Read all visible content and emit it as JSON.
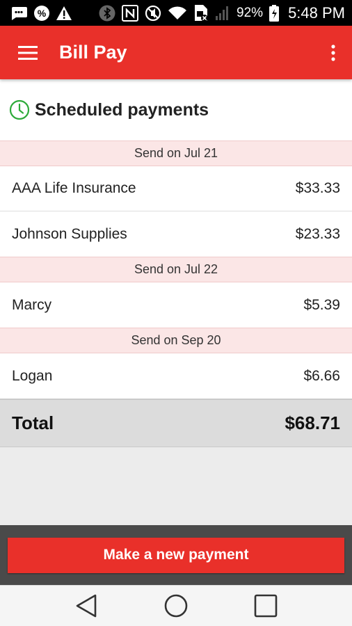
{
  "status_bar": {
    "battery_percent": "92%",
    "time": "5:48 PM",
    "icons": [
      "message-icon",
      "percent-icon",
      "warning-icon",
      "bluetooth-icon",
      "nfc-icon",
      "mute-icon",
      "wifi-icon",
      "no-sim-icon",
      "signal-icon",
      "battery-icon"
    ]
  },
  "app_bar": {
    "title": "Bill Pay",
    "background": "#e9302a"
  },
  "section": {
    "title": "Scheduled payments",
    "icon": "clock-icon",
    "icon_color": "#2eaa3a"
  },
  "groups": [
    {
      "date_label": "Send on Jul 21",
      "payments": [
        {
          "payee": "AAA Life Insurance",
          "amount": "$33.33"
        },
        {
          "payee": "Johnson Supplies",
          "amount": "$23.33"
        }
      ]
    },
    {
      "date_label": "Send on Jul 22",
      "payments": [
        {
          "payee": "Marcy",
          "amount": "$5.39"
        }
      ]
    },
    {
      "date_label": "Send on Sep 20",
      "payments": [
        {
          "payee": "Logan",
          "amount": "$6.66"
        }
      ]
    }
  ],
  "total": {
    "label": "Total",
    "amount": "$68.71"
  },
  "action": {
    "label": "Make a new payment"
  },
  "nav": {
    "icons": [
      "back-icon",
      "home-icon",
      "recents-icon"
    ]
  }
}
